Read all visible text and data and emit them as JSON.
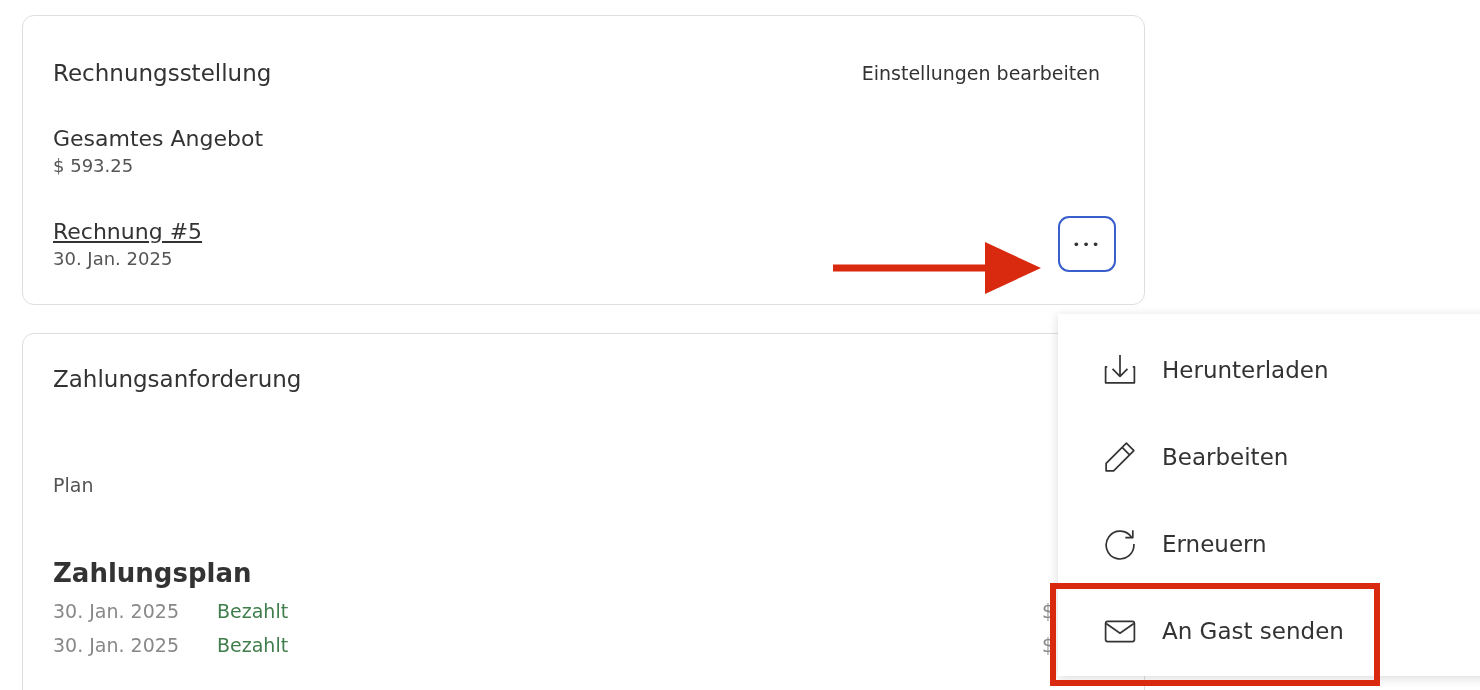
{
  "billing": {
    "title": "Rechnungsstellung",
    "edit_link": "Einstellungen bearbeiten",
    "total_label": "Gesamtes Angebot",
    "total_value": "$ 593.25",
    "invoice": {
      "link": "Rechnung #5",
      "date": "30. Jan. 2025",
      "more_button": {
        "label": "•••",
        "focused": true
      }
    }
  },
  "payment_request": {
    "title": "Zahlungsanforderung",
    "plan_label": "Plan",
    "plan_title": "Zahlungsplan",
    "rows": [
      {
        "date": "30. Jan. 2025",
        "status": "Bezahlt",
        "amount": "$"
      },
      {
        "date": "30. Jan. 2025",
        "status": "Bezahlt",
        "amount": "$"
      }
    ]
  },
  "menu": {
    "items": [
      {
        "kind": "download",
        "label": "Herunterladen",
        "highlighted": false
      },
      {
        "kind": "edit",
        "label": "Bearbeiten",
        "highlighted": false
      },
      {
        "kind": "renew",
        "label": "Erneuern",
        "highlighted": false
      },
      {
        "kind": "send",
        "label": "An Gast senden",
        "highlighted": true
      }
    ]
  }
}
